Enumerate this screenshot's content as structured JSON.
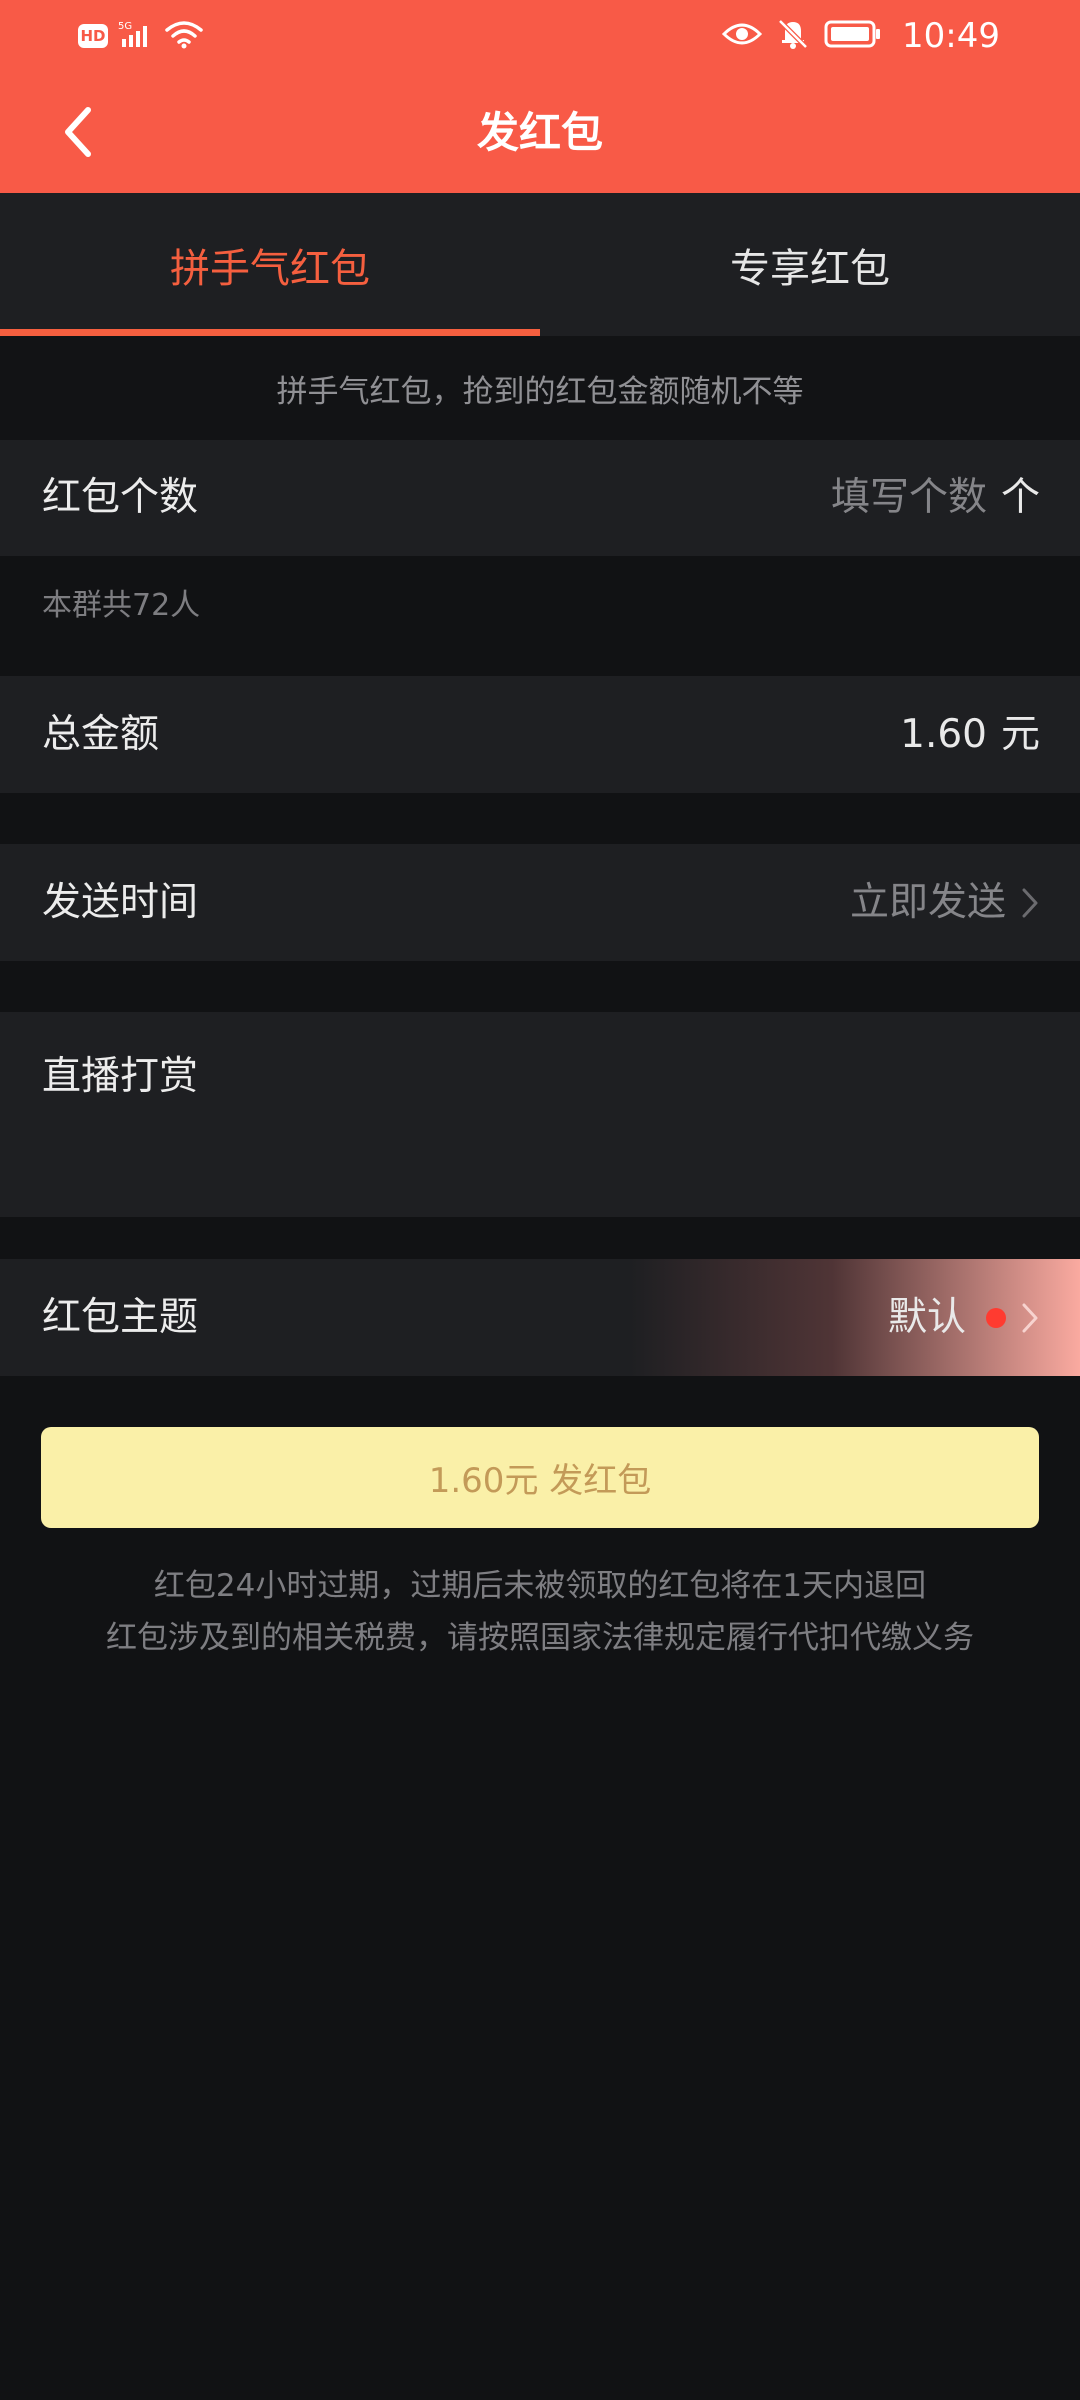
{
  "status_bar": {
    "hd_label": "HD",
    "network_label": "5G",
    "time": "10:49"
  },
  "title_bar": {
    "title": "发红包"
  },
  "tabs": [
    {
      "label": "拼手气红包",
      "active": true
    },
    {
      "label": "专享红包",
      "active": false
    }
  ],
  "hint": "拼手气红包，抢到的红包金额随机不等",
  "form": {
    "count": {
      "label": "红包个数",
      "placeholder": "填写个数",
      "unit": "个"
    },
    "group_note": "本群共72人",
    "amount": {
      "label": "总金额",
      "value": "1.60",
      "unit": "元"
    },
    "send_time": {
      "label": "发送时间",
      "value": "立即发送"
    },
    "live_reward": {
      "label": "直播打赏"
    },
    "theme": {
      "label": "红包主题",
      "value": "默认"
    }
  },
  "send_button": {
    "label": "1.60元 发红包"
  },
  "footer_notes": [
    "红包24小时过期，过期后未被领取的红包将在1天内退回",
    "红包涉及到的相关税费，请按照国家法律规定履行代扣代缴义务"
  ],
  "colors": {
    "header_bg": "#f85a47",
    "accent": "#f55f3f",
    "button_bg": "#faf0a8",
    "button_text": "#c39a58",
    "dot": "#ff3b30"
  }
}
